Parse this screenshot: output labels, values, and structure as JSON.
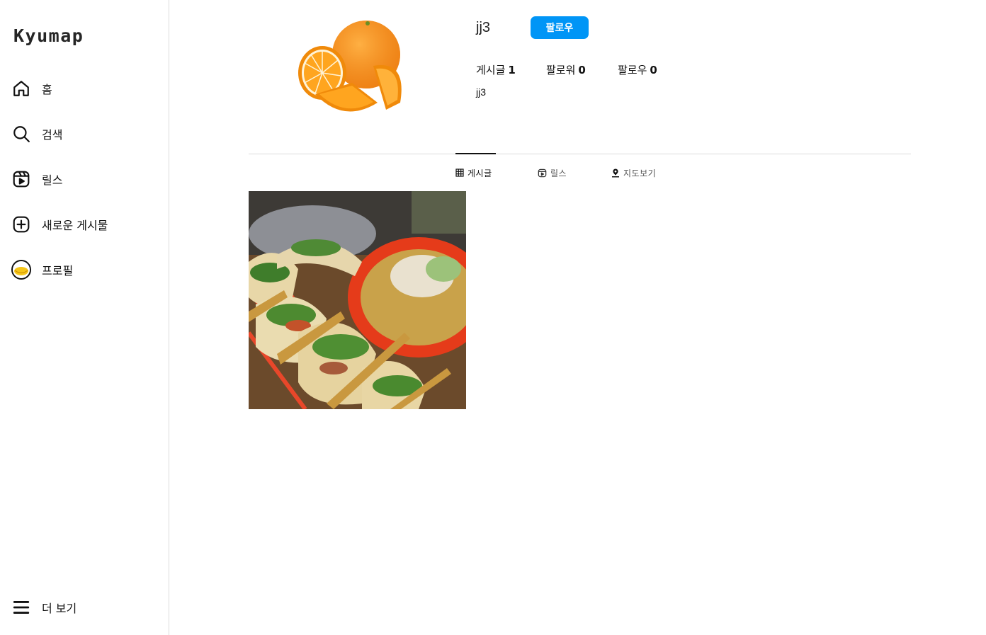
{
  "sidebar": {
    "logo": "Kyumap",
    "items": [
      {
        "label": "홈",
        "icon": "home-icon"
      },
      {
        "label": "검색",
        "icon": "search-icon"
      },
      {
        "label": "릴스",
        "icon": "reels-icon"
      },
      {
        "label": "새로운 게시물",
        "icon": "plus-square-icon"
      },
      {
        "label": "프로필",
        "icon": "profile-avatar"
      }
    ],
    "more": {
      "label": "더 보기",
      "icon": "menu-icon"
    }
  },
  "profile": {
    "username": "jj3",
    "follow_label": "팔로우",
    "stats": [
      {
        "label": "게시글",
        "value": "1"
      },
      {
        "label": "팔로워",
        "value": "0"
      },
      {
        "label": "팔로우",
        "value": "0"
      }
    ],
    "bio_name": "jj3"
  },
  "tabs": [
    {
      "label": "게시글",
      "icon": "grid-icon",
      "active": true
    },
    {
      "label": "릴스",
      "icon": "reels-icon",
      "active": false
    },
    {
      "label": "지도보기",
      "icon": "map-pin-icon",
      "active": false
    }
  ],
  "colors": {
    "accent": "#0095f6",
    "border": "#dbdbdb"
  }
}
